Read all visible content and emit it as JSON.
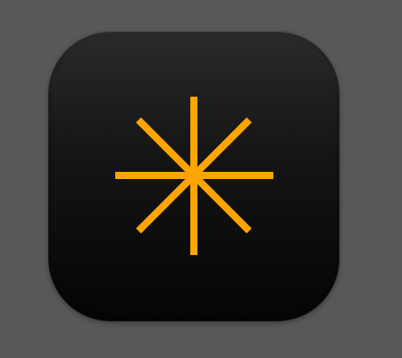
{
  "icon": {
    "name": "asterisk-star-icon",
    "background_color": "#0b0b0b",
    "glyph_color": "#FFA500"
  },
  "page": {
    "background_color": "#585858"
  }
}
